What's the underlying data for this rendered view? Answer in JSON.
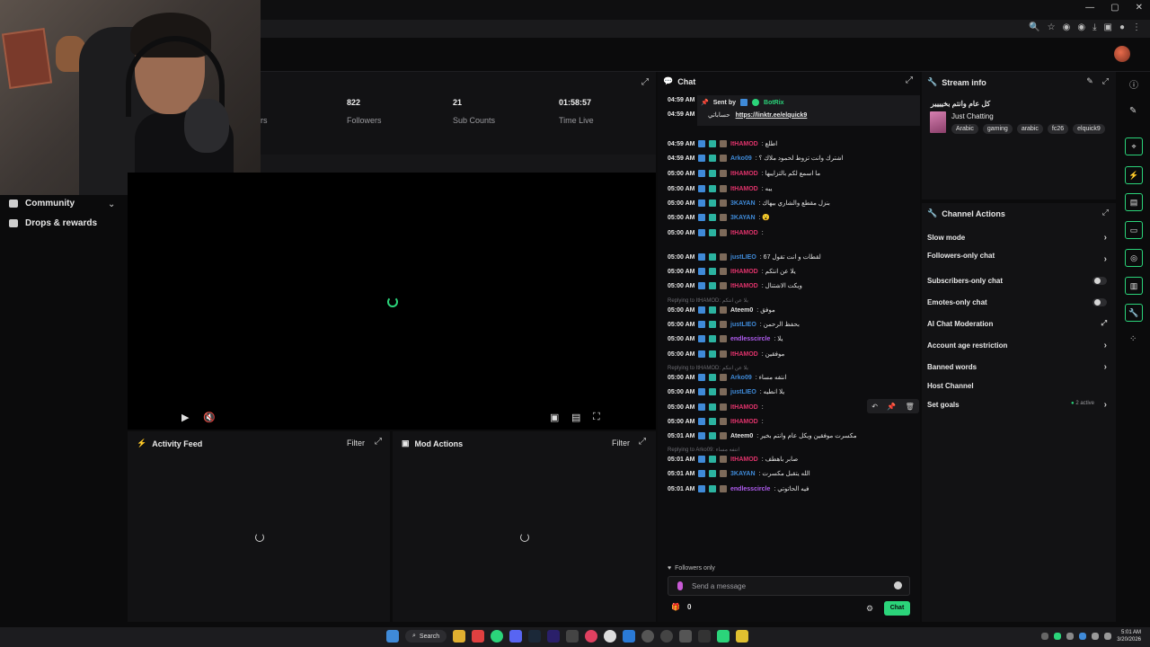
{
  "nav": {
    "community": "Community",
    "drops": "Drops & rewards"
  },
  "stats": {
    "followers_value": "822",
    "followers_label": "Followers",
    "subs_value": "21",
    "subs_label": "Sub Counts",
    "time_value": "01:58:57",
    "time_label": "Time Live",
    "partial_label": "rs"
  },
  "panels": {
    "activity_title": "Activity Feed",
    "activity_filter": "Filter",
    "mod_title": "Mod Actions",
    "mod_filter": "Filter"
  },
  "chat": {
    "title": "Chat",
    "pinned_sent_by": "Sent by",
    "pinned_bot": "BotRix",
    "pinned_time1": "04:59 AM",
    "pinned_time2": "04:59 AM",
    "pinned_text": "حساباتي",
    "pinned_link": "https://linktr.ee/elquick9",
    "messages": [
      {
        "time": "04:59 AM",
        "user": "ItHAMOD",
        "color": "#e0336b",
        "text": ": اطلع"
      },
      {
        "time": "04:59 AM",
        "user": "Arko09",
        "color": "#3f8ad8",
        "text": ": اشترك وانت تزوط لحمود ملاك ؟"
      },
      {
        "time": "05:00 AM",
        "user": "ItHAMOD",
        "color": "#e0336b",
        "text": ": ما اسمع لكم بالتزايبها"
      },
      {
        "time": "05:00 AM",
        "user": "ItHAMOD",
        "color": "#e0336b",
        "text": ": يبه"
      },
      {
        "time": "05:00 AM",
        "user": "3KAYAN",
        "color": "#3f8ad8",
        "text": ": بنزل مقطع والشاري بيهاك"
      },
      {
        "time": "05:00 AM",
        "user": "3KAYAN",
        "color": "#3f8ad8",
        "text": ": 😮"
      },
      {
        "time": "05:00 AM",
        "user": "ItHAMOD",
        "color": "#e0336b",
        "text": ":"
      },
      {
        "time": "05:00 AM",
        "user": "justLIEO",
        "color": "#3f8ad8",
        "text": ": 67 لقطات و انت تقول"
      },
      {
        "time": "05:00 AM",
        "user": "ItHAMOD",
        "color": "#e0336b",
        "text": ": يلا عن انتكم"
      },
      {
        "time": "05:00 AM",
        "user": "ItHAMOD",
        "color": "#e0336b",
        "text": ": ويكت الاشتنال"
      },
      {
        "time": "05:00 AM",
        "user": "Ateem0",
        "color": "#e6e6e6",
        "text": ": موفق"
      },
      {
        "time": "05:00 AM",
        "user": "justLIEO",
        "color": "#3f8ad8",
        "text": ": بحفظ الرحمن"
      },
      {
        "time": "05:00 AM",
        "user": "endlesscircle",
        "color": "#b05cf0",
        "text": ": يلا"
      },
      {
        "time": "05:00 AM",
        "user": "ItHAMOD",
        "color": "#e0336b",
        "text": ": موفقين"
      },
      {
        "time": "05:00 AM",
        "user": "Arko09",
        "color": "#3f8ad8",
        "text": ": انتفه مساء"
      },
      {
        "time": "05:00 AM",
        "user": "justLIEO",
        "color": "#3f8ad8",
        "text": ": يلا انطيه"
      },
      {
        "time": "05:00 AM",
        "user": "ItHAMOD",
        "color": "#e0336b",
        "text": ":"
      },
      {
        "time": "05:00 AM",
        "user": "ItHAMOD",
        "color": "#e0336b",
        "text": ":"
      },
      {
        "time": "05:01 AM",
        "user": "Ateem0",
        "color": "#e6e6e6",
        "text": ": مكسرت موفقين ويكل عام وانتم بخير"
      },
      {
        "time": "05:01 AM",
        "user": "ItHAMOD",
        "color": "#e0336b",
        "text": ": صابر باهطف"
      },
      {
        "time": "05:01 AM",
        "user": "3KAYAN",
        "color": "#3f8ad8",
        "text": ": الله يتقبل مكسرت"
      },
      {
        "time": "05:01 AM",
        "user": "endlesscircle",
        "color": "#b05cf0",
        "text": ": فيه الحاتوتي"
      }
    ],
    "replies": [
      "Replying to ItHAMOD:  يلا عن انتكم",
      "Replying to ItHAMOD:  يلا عن انتكم",
      "Replying to Arko09:  انتفه مساء"
    ],
    "followers_only": "Followers only",
    "send_placeholder": "Send a message",
    "count": "0",
    "chat_button": "Chat"
  },
  "stream_info": {
    "title": "Stream info",
    "stream_title": "كل عام وانتم بخيييير",
    "category": "Just Chatting",
    "tags": [
      "Arabic",
      "gaming",
      "arabic",
      "fc26",
      "elquick9"
    ]
  },
  "channel_actions": {
    "title": "Channel Actions",
    "slow_mode": "Slow mode",
    "followers_only": "Followers-only chat",
    "subscribers_only": "Subscribers-only chat",
    "emotes_only": "Emotes-only chat",
    "ai_moderation": "AI Chat Moderation",
    "age_restriction": "Account age restriction",
    "banned_words": "Banned words",
    "host_channel": "Host Channel",
    "set_goals": "Set goals",
    "goals_active": "2 active"
  },
  "taskbar": {
    "search": "Search",
    "time": "5:01 AM",
    "date": "3/20/2026"
  },
  "colors": {
    "accent": "#2bd47a",
    "mod_red": "#e0336b",
    "sub_purple": "#b05cf0"
  }
}
